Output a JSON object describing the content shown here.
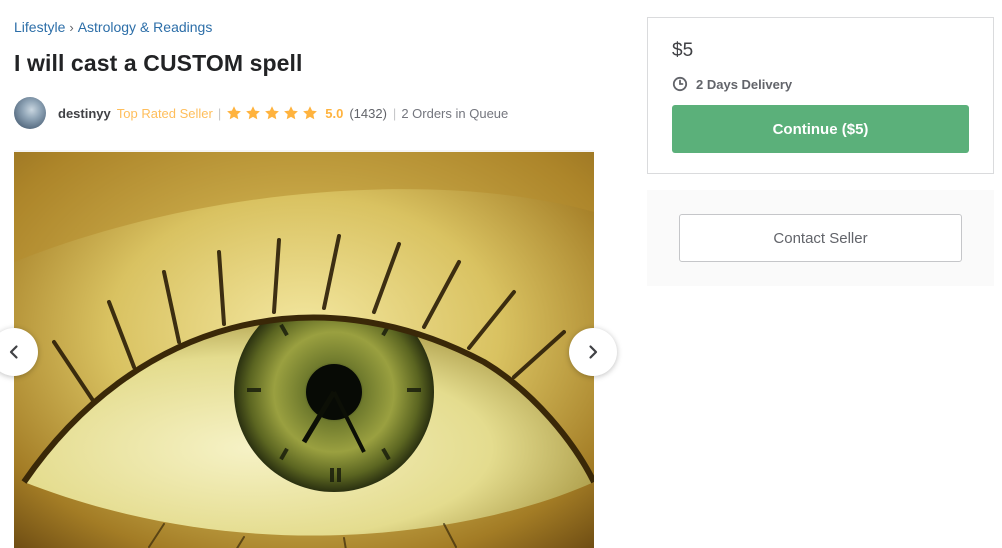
{
  "breadcrumb": {
    "items": [
      "Lifestyle",
      "Astrology & Readings"
    ],
    "separator": "›"
  },
  "gig": {
    "title": "I will cast a CUSTOM spell"
  },
  "seller": {
    "name": "destinyy",
    "level": "Top Rated Seller",
    "rating": "5.0",
    "reviews": "(1432)",
    "queue": "2 Orders in Queue",
    "stars": 5
  },
  "gallery": {
    "image": "eye-with-clock-iris-image",
    "prev_icon": "chevron-left-icon",
    "next_icon": "chevron-right-icon"
  },
  "order": {
    "price": "$5",
    "delivery": "2 Days Delivery",
    "delivery_icon": "clock-icon",
    "continue_label": "Continue ($5)",
    "button_color": "#5bb07a"
  },
  "contact": {
    "label": "Contact Seller"
  },
  "colors": {
    "link": "#2c6ea8",
    "top_rated": "#ffbe5b",
    "star": "#ffb33e"
  }
}
